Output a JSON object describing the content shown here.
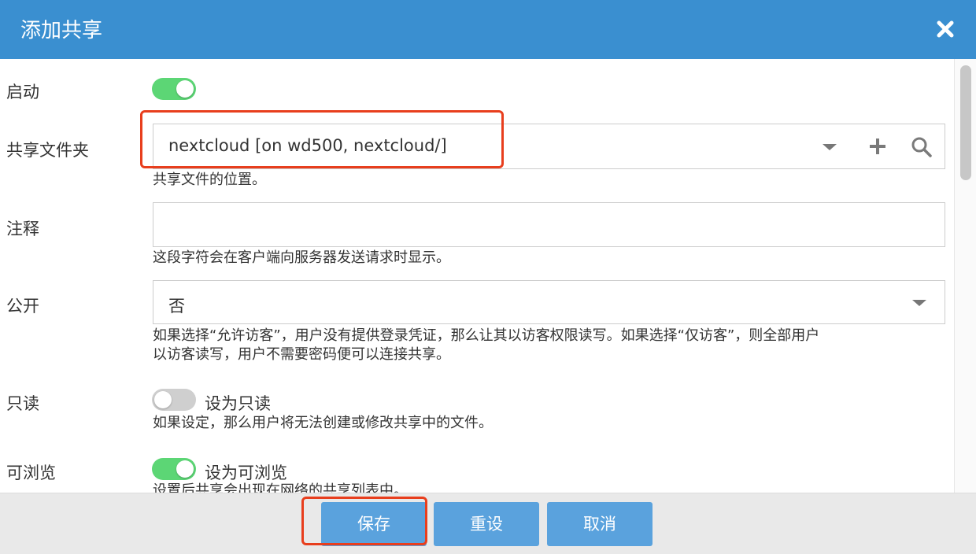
{
  "dialog": {
    "title": "添加共享"
  },
  "enable": {
    "label": "启动",
    "state": "on"
  },
  "shared_folder": {
    "label": "共享文件夹",
    "value": "nextcloud [on wd500, nextcloud/]",
    "help": "共享文件的位置。"
  },
  "comment": {
    "label": "注释",
    "value": "",
    "help": "这段字符会在客户端向服务器发送请求时显示。"
  },
  "public": {
    "label": "公开",
    "value": "否",
    "help_line1": "如果选择“允许访客”，用户没有提供登录凭证，那么让其以访客权限读写。如果选择“仅访客”，则全部用户",
    "help_line2": "以访客读写，用户不需要密码便可以连接共享。"
  },
  "readonly": {
    "label": "只读",
    "toggle_label": "设为只读",
    "state": "off",
    "help": "如果设定，那么用户将无法创建或修改共享中的文件。"
  },
  "browsable": {
    "label": "可浏览",
    "toggle_label": "设为可浏览",
    "state": "on",
    "help": "设置后共享会出现在网络的共享列表中。"
  },
  "footer": {
    "save": "保存",
    "reset": "重设",
    "cancel": "取消"
  },
  "colors": {
    "header": "#3a8fd0",
    "switch_on": "#5cd675",
    "switch_off": "#cfcfcf",
    "button": "#5aa2dd",
    "highlight": "#e83e1d"
  },
  "icons": {
    "close": "close-icon",
    "dropdown": "chevron-down-icon",
    "add": "plus-icon",
    "search": "search-icon"
  }
}
